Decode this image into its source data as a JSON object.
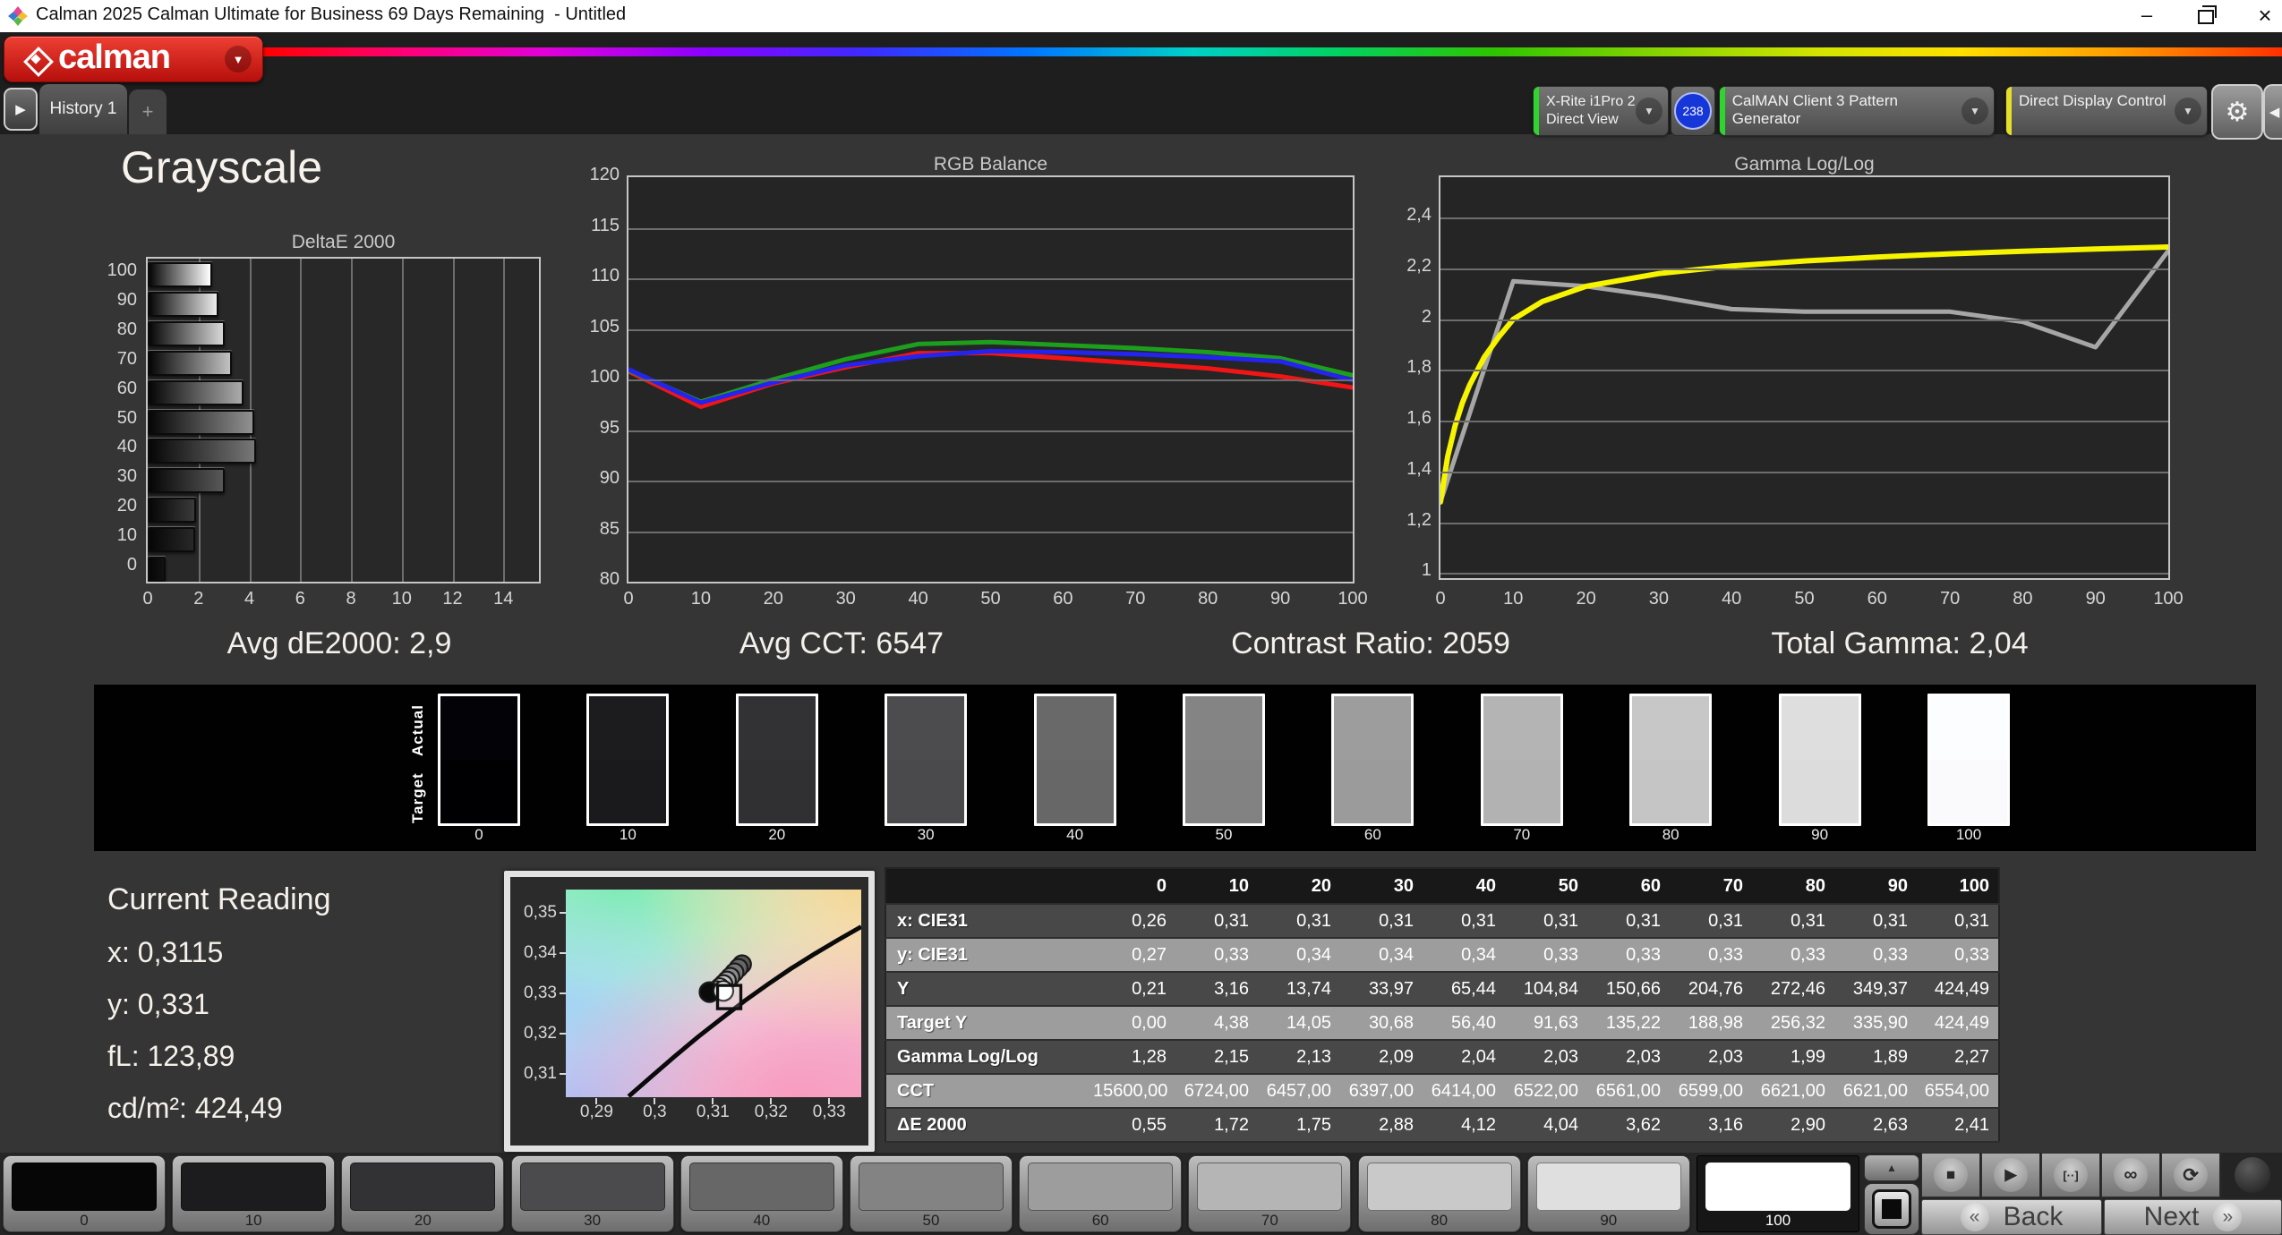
{
  "window": {
    "title": "Calman 2025 Calman Ultimate for Business 69 Days Remaining  - Untitled",
    "minimize_glyph": "–",
    "close_glyph": "×"
  },
  "brand": {
    "logo_text": "calman",
    "dropdown_glyph": "▼"
  },
  "tabs": {
    "play_glyph": "▶",
    "history_label": "History 1",
    "add_label": "+"
  },
  "toolbar": {
    "meter": {
      "line1": "X-Rite i1Pro 2",
      "line2": "Direct View",
      "status_color": "#2fd42f"
    },
    "badge": "238",
    "pattern": {
      "label": "CalMAN Client 3 Pattern Generator",
      "status_color": "#2fd42f"
    },
    "display": {
      "label": "Direct Display Control",
      "status_color": "#e6df2a"
    },
    "gear_glyph": "⚙",
    "collapse_glyph": "◀",
    "arrow_glyph": "▼"
  },
  "page_title": "Grayscale",
  "stats": {
    "avg_de": "Avg dE2000: 2,9",
    "avg_cct": "Avg CCT: 6547",
    "contrast": "Contrast Ratio: 2059",
    "total_gamma": "Total Gamma: 2,04"
  },
  "current_reading": {
    "title": "Current Reading",
    "x": "x: 0,3115",
    "y": "y: 0,331",
    "fl": "fL: 123,89",
    "cdm2": "cd/m²: 424,49"
  },
  "swatch_strip": {
    "actual_label": "Actual",
    "target_label": "Target",
    "levels": [
      "0",
      "10",
      "20",
      "30",
      "40",
      "50",
      "60",
      "70",
      "80",
      "90",
      "100"
    ],
    "actual_colors": [
      "#020207",
      "#1c1c1e",
      "#323234",
      "#4c4c4e",
      "#696969",
      "#848484",
      "#9d9d9d",
      "#b4b4b4",
      "#c7c7c7",
      "#dedede",
      "#fcfdff"
    ],
    "target_colors": [
      "#000002",
      "#1a1a1c",
      "#303032",
      "#4a4a4c",
      "#676767",
      "#828282",
      "#9b9b9b",
      "#b2b2b2",
      "#c5c5c5",
      "#dcdcdc",
      "#fafafc"
    ]
  },
  "table": {
    "col_headers": [
      "0",
      "10",
      "20",
      "30",
      "40",
      "50",
      "60",
      "70",
      "80",
      "90",
      "100"
    ],
    "rows": [
      {
        "label": "x: CIE31",
        "shade": "dark",
        "values": [
          "0,26",
          "0,31",
          "0,31",
          "0,31",
          "0,31",
          "0,31",
          "0,31",
          "0,31",
          "0,31",
          "0,31",
          "0,31"
        ]
      },
      {
        "label": "y: CIE31",
        "shade": "light",
        "values": [
          "0,27",
          "0,33",
          "0,34",
          "0,34",
          "0,34",
          "0,33",
          "0,33",
          "0,33",
          "0,33",
          "0,33",
          "0,33"
        ]
      },
      {
        "label": "Y",
        "shade": "dark",
        "values": [
          "0,21",
          "3,16",
          "13,74",
          "33,97",
          "65,44",
          "104,84",
          "150,66",
          "204,76",
          "272,46",
          "349,37",
          "424,49"
        ]
      },
      {
        "label": "Target Y",
        "shade": "light",
        "values": [
          "0,00",
          "4,38",
          "14,05",
          "30,68",
          "56,40",
          "91,63",
          "135,22",
          "188,98",
          "256,32",
          "335,90",
          "424,49"
        ]
      },
      {
        "label": "Gamma Log/Log",
        "shade": "dark",
        "values": [
          "1,28",
          "2,15",
          "2,13",
          "2,09",
          "2,04",
          "2,03",
          "2,03",
          "2,03",
          "1,99",
          "1,89",
          "2,27"
        ]
      },
      {
        "label": "CCT",
        "shade": "light",
        "values": [
          "15600,00",
          "6724,00",
          "6457,00",
          "6397,00",
          "6414,00",
          "6522,00",
          "6561,00",
          "6599,00",
          "6621,00",
          "6621,00",
          "6554,00"
        ]
      },
      {
        "label": "ΔE 2000",
        "shade": "dark",
        "values": [
          "0,55",
          "1,72",
          "1,75",
          "2,88",
          "4,12",
          "4,04",
          "3,62",
          "3,16",
          "2,90",
          "2,63",
          "2,41"
        ]
      }
    ]
  },
  "bottom": {
    "patch_labels": [
      "0",
      "10",
      "20",
      "30",
      "40",
      "50",
      "60",
      "70",
      "80",
      "90",
      "100"
    ],
    "patch_colors": [
      "#060606",
      "#1c1c1e",
      "#323234",
      "#4b4b4d",
      "#676767",
      "#838383",
      "#9d9d9d",
      "#b5b5b5",
      "#c9c9c9",
      "#dfdfdf",
      "#ffffff"
    ],
    "selected_index": 10,
    "up_glyph": "▲",
    "transport": [
      {
        "name": "stop",
        "glyph": "■"
      },
      {
        "name": "play",
        "glyph": "▶"
      },
      {
        "name": "step",
        "glyph": "[··]"
      },
      {
        "name": "continuous",
        "glyph": "∞"
      },
      {
        "name": "refresh",
        "glyph": "⟳"
      }
    ],
    "back_chev": "«",
    "back_label": "Back",
    "next_label": "Next",
    "next_chev": "»"
  },
  "chart_data": [
    {
      "id": "deltae",
      "type": "bar",
      "orientation": "horizontal",
      "title": "DeltaE 2000",
      "categories": [
        "100",
        "90",
        "80",
        "70",
        "60",
        "50",
        "40",
        "30",
        "20",
        "10",
        "0"
      ],
      "values": [
        2.41,
        2.63,
        2.9,
        3.16,
        3.62,
        4.04,
        4.12,
        2.88,
        1.75,
        1.72,
        0.55
      ],
      "bar_end_colors": [
        "#ffffff",
        "#ececec",
        "#d8d8d8",
        "#c2c2c2",
        "#ababab",
        "#919191",
        "#777777",
        "#585858",
        "#3a3a3a",
        "#282828",
        "#121212"
      ],
      "xlim": [
        0,
        15.4
      ],
      "xticks": [
        0,
        2,
        4,
        6,
        8,
        10,
        12,
        14
      ],
      "xtick_labels": [
        "0",
        "2",
        "4",
        "6",
        "8",
        "10",
        "12",
        "14"
      ],
      "xlabel": "",
      "ylabel": ""
    },
    {
      "id": "rgb",
      "type": "line",
      "title": "RGB Balance",
      "x": [
        0,
        10,
        20,
        30,
        40,
        50,
        60,
        70,
        80,
        90,
        100
      ],
      "xlim": [
        0,
        100
      ],
      "xticks": [
        0,
        10,
        20,
        30,
        40,
        50,
        60,
        70,
        80,
        90,
        100
      ],
      "xtick_labels": [
        "0",
        "10",
        "20",
        "30",
        "40",
        "50",
        "60",
        "70",
        "80",
        "90",
        "100"
      ],
      "ylim": [
        80,
        120
      ],
      "yticks": [
        80,
        85,
        90,
        95,
        100,
        105,
        110,
        115,
        120
      ],
      "ytick_labels": [
        "80",
        "85",
        "90",
        "95",
        "100",
        "105",
        "110",
        "115",
        "120"
      ],
      "series": [
        {
          "name": "red",
          "color": "#f21515",
          "values": [
            100.8,
            97.3,
            99.6,
            101.2,
            102.6,
            102.6,
            102.1,
            101.6,
            101.1,
            100.3,
            99.2
          ]
        },
        {
          "name": "green",
          "color": "#1d9e1d",
          "values": [
            100.9,
            97.8,
            100.0,
            102.0,
            103.5,
            103.7,
            103.4,
            103.1,
            102.7,
            102.1,
            100.4
          ]
        },
        {
          "name": "blue",
          "color": "#2424ee",
          "values": [
            101.0,
            97.7,
            99.7,
            101.4,
            102.3,
            102.8,
            102.7,
            102.5,
            102.2,
            101.8,
            99.9
          ]
        }
      ]
    },
    {
      "id": "gamma",
      "type": "line",
      "title": "Gamma Log/Log",
      "xlim": [
        0,
        100
      ],
      "xticks": [
        0,
        10,
        20,
        30,
        40,
        50,
        60,
        70,
        80,
        90,
        100
      ],
      "xtick_labels": [
        "0",
        "10",
        "20",
        "30",
        "40",
        "50",
        "60",
        "70",
        "80",
        "90",
        "100"
      ],
      "ylim": [
        0.98,
        2.56
      ],
      "yticks": [
        1,
        1.2,
        1.4,
        1.6,
        1.8,
        2,
        2.2,
        2.4
      ],
      "ytick_labels": [
        "1",
        "1,2",
        "1,4",
        "1,6",
        "1,8",
        "2",
        "2,2",
        "2,4"
      ],
      "series": [
        {
          "name": "measured",
          "color": "#a6a6a6",
          "width": 5,
          "x": [
            0,
            10,
            20,
            30,
            40,
            50,
            60,
            70,
            80,
            90,
            100
          ],
          "values": [
            1.28,
            2.15,
            2.13,
            2.09,
            2.04,
            2.03,
            2.03,
            2.03,
            1.99,
            1.89,
            2.27
          ]
        },
        {
          "name": "target",
          "color": "#f7f400",
          "width": 6,
          "x": [
            0,
            1,
            2,
            3,
            4,
            6,
            8,
            10,
            14,
            20,
            30,
            40,
            50,
            60,
            70,
            80,
            90,
            100
          ],
          "values": [
            1.28,
            1.46,
            1.58,
            1.67,
            1.74,
            1.85,
            1.93,
            2.0,
            2.07,
            2.13,
            2.18,
            2.21,
            2.23,
            2.245,
            2.258,
            2.268,
            2.277,
            2.285
          ]
        }
      ]
    },
    {
      "id": "cie",
      "type": "scatter",
      "title": "CIE 1931 xy detail",
      "xlim": [
        0.2847,
        0.3355
      ],
      "ylim": [
        0.3043,
        0.3557
      ],
      "xticks": [
        0.29,
        0.3,
        0.31,
        0.32,
        0.33
      ],
      "xtick_labels": [
        "0,29",
        "0,3",
        "0,31",
        "0,32",
        "0,33"
      ],
      "yticks": [
        0.31,
        0.32,
        0.33,
        0.34,
        0.35
      ],
      "ytick_labels": [
        "0,31",
        "0,32",
        "0,33",
        "0,34",
        "0,35"
      ],
      "locus": [
        [
          0.2955,
          0.3045
        ],
        [
          0.2995,
          0.3095
        ],
        [
          0.3035,
          0.3145
        ],
        [
          0.3075,
          0.3193
        ],
        [
          0.3115,
          0.3238
        ],
        [
          0.3155,
          0.3282
        ],
        [
          0.3195,
          0.3323
        ],
        [
          0.3235,
          0.3362
        ],
        [
          0.3275,
          0.3398
        ],
        [
          0.3315,
          0.3432
        ],
        [
          0.3355,
          0.3465
        ]
      ],
      "points": [
        {
          "x": 0.315,
          "y": 0.3372,
          "color": "#565656"
        },
        {
          "x": 0.3144,
          "y": 0.3363,
          "color": "#676767"
        },
        {
          "x": 0.3137,
          "y": 0.3352,
          "color": "#787878"
        },
        {
          "x": 0.313,
          "y": 0.3341,
          "color": "#8b8b8b"
        },
        {
          "x": 0.3124,
          "y": 0.3332,
          "color": "#a0a0a0"
        },
        {
          "x": 0.3118,
          "y": 0.3323,
          "color": "#c2c2c2"
        },
        {
          "x": 0.3112,
          "y": 0.3315,
          "color": "#d8d8d8"
        },
        {
          "x": 0.3106,
          "y": 0.3308,
          "color": "#efefef"
        },
        {
          "x": 0.3094,
          "y": 0.3303,
          "color": "#0b0b0b"
        },
        {
          "x": 0.3118,
          "y": 0.3306,
          "color": "#ffffff"
        }
      ],
      "target": {
        "x": 0.3128,
        "y": 0.3291
      }
    }
  ]
}
